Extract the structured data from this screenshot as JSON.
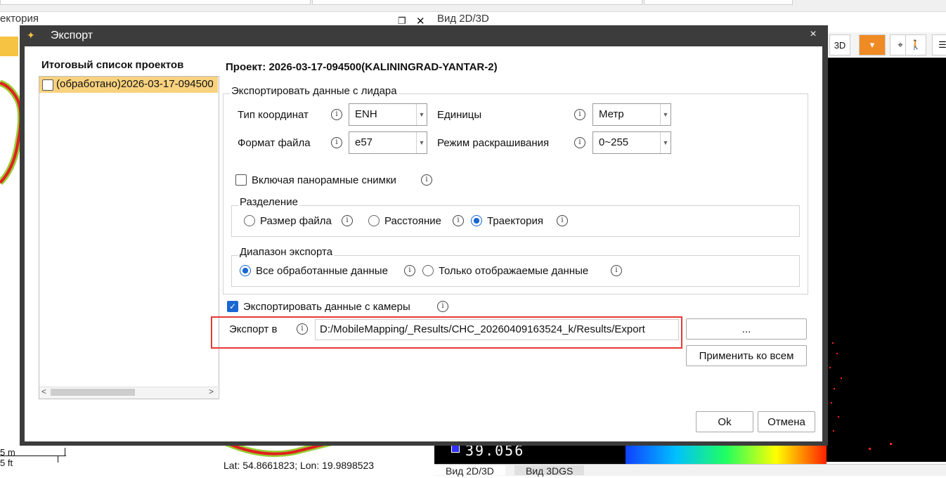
{
  "background": {
    "left_panel_title": "ектория",
    "right_panel_title": "Вид 2D/3D",
    "bottom_tabs": [
      "Вид 2D/3D",
      "Вид 3DGS"
    ],
    "status_coords": "Lat: 54.8661823; Lon: 19.9898523",
    "scale_m": "5 m",
    "scale_ft": "5 ft",
    "elevation_readout": "39.056"
  },
  "dialog": {
    "title": "Экспорт",
    "close_glyph": "×",
    "project_list_header": "Итоговый список проектов",
    "project_item": "(обработано)2026-03-17-094500",
    "project_title": "Проект: 2026-03-17-094500(KALININGRAD-YANTAR-2)",
    "lidar_group": "Экспортировать данные с лидара",
    "coord_type_label": "Тип координат",
    "coord_type_value": "ENH",
    "units_label": "Единицы",
    "units_value": "Метр",
    "file_format_label": "Формат файла",
    "file_format_value": "e57",
    "color_mode_label": "Режим раскрашивания",
    "color_mode_value": "0~255",
    "include_pano_label": "Включая панорамные снимки",
    "split_group": "Разделение",
    "split_options": [
      "Размер файла",
      "Расстояние",
      "Траектория"
    ],
    "split_selected": "Траектория",
    "range_group": "Диапазон экспорта",
    "range_options": [
      "Все обработанные данные",
      "Только отображаемые данные"
    ],
    "range_selected": "Все обработанные данные",
    "export_camera_label": "Экспортировать данные с камеры",
    "export_to_label": "Экспорт в",
    "export_path": "D:/MobileMapping/_Results/CHC_20260409163524_k/Results/Export",
    "browse_button": "...",
    "apply_all_button": "Применить ко всем",
    "ok_button": "Ok",
    "cancel_button": "Отмена",
    "info_glyph": "i"
  },
  "colors": {
    "accent": "#1967d2",
    "highlight_row": "#f9d27f",
    "titlebar": "#3c3c3c",
    "red_outline": "#e53935"
  }
}
